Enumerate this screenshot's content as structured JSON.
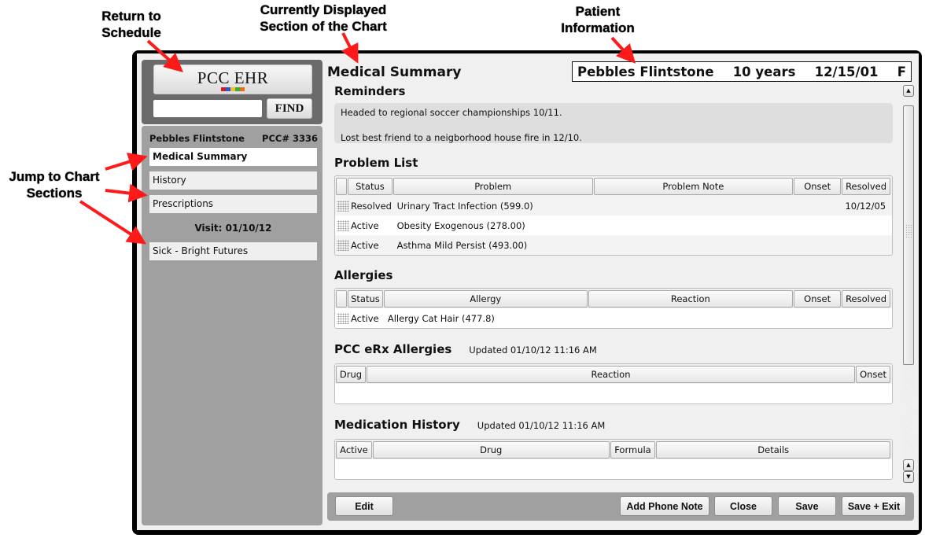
{
  "annotations": {
    "return_to_schedule": "Return to\nSchedule",
    "current_section": "Currently Displayed\nSection of the Chart",
    "patient_information": "Patient\nInformation",
    "jump_to_sections": "Jump to Chart\nSections"
  },
  "logo": {
    "text": "PCC EHR",
    "square_colors": [
      "#d91a1a",
      "#1a5ae0",
      "#f2c21a",
      "#2fb23a",
      "#f06a12"
    ]
  },
  "search": {
    "value": "",
    "placeholder": "",
    "find_label": "FIND"
  },
  "sidebar": {
    "patient_name": "Pebbles Flintstone",
    "pcc_number": "PCC# 3336",
    "items": [
      {
        "label": "Medical Summary",
        "active": true
      },
      {
        "label": "History",
        "active": false
      },
      {
        "label": "Prescriptions",
        "active": false
      }
    ],
    "visit_label": "Visit: 01/10/12",
    "visit_items": [
      {
        "label": "Sick - Bright Futures"
      }
    ]
  },
  "header": {
    "page_title": "Medical Summary",
    "patient": {
      "name": "Pebbles Flintstone",
      "age": "10 years",
      "dob": "12/15/01",
      "sex": "F"
    }
  },
  "reminders": {
    "title": "Reminders",
    "lines": [
      "Headed to regional soccer championships 10/11.",
      "Lost best friend to a neigborhood house fire in 12/10."
    ]
  },
  "problem_list": {
    "title": "Problem List",
    "columns": [
      "Status",
      "Problem",
      "Problem Note",
      "Onset",
      "Resolved"
    ],
    "rows": [
      [
        "Resolved",
        "Urinary Tract Infection (599.0)",
        "",
        "",
        "10/12/05"
      ],
      [
        "Active",
        "Obesity Exogenous (278.00)",
        "",
        "",
        ""
      ],
      [
        "Active",
        "Asthma Mild Persist (493.00)",
        "",
        "",
        ""
      ]
    ]
  },
  "allergies": {
    "title": "Allergies",
    "columns": [
      "Status",
      "Allergy",
      "Reaction",
      "Onset",
      "Resolved"
    ],
    "rows": [
      [
        "Active",
        "Allergy Cat Hair (477.8)",
        "",
        "",
        ""
      ]
    ]
  },
  "erx_allergies": {
    "title": "PCC eRx Allergies",
    "updated": "Updated 01/10/12 11:16 AM",
    "columns": [
      "Drug",
      "Reaction",
      "Onset"
    ],
    "rows": []
  },
  "medication_history": {
    "title": "Medication History",
    "updated": "Updated 01/10/12 11:16 AM",
    "columns": [
      "Active",
      "Drug",
      "Formula",
      "Details"
    ],
    "rows": []
  },
  "toolbar": {
    "edit_label": "Edit",
    "add_phone_note_label": "Add Phone Note",
    "close_label": "Close",
    "save_label": "Save",
    "save_exit_label": "Save + Exit"
  },
  "scrollbar": {
    "up_icon": "▲",
    "down_icon": "▼"
  }
}
